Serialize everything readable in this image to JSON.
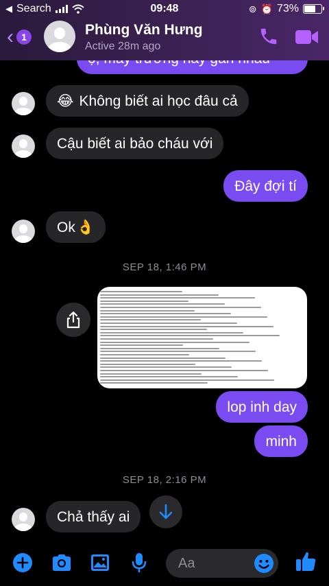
{
  "status": {
    "carrier": "Search",
    "time": "09:48",
    "battery": "73%",
    "battery_level": 0.73
  },
  "header": {
    "back_count": "1",
    "contact_name": "Phùng Văn Hưng",
    "active_status": "Active 28m ago",
    "icons": [
      "back-chevron-icon",
      "phone-icon",
      "video-camera-icon"
    ]
  },
  "messages": [
    {
      "dir": "out",
      "text": "ọ, mấy trường hay gần nhau"
    },
    {
      "dir": "in",
      "emoji": "😂",
      "text": "Không biết ai học đâu cả"
    },
    {
      "dir": "in",
      "text": "Cậu biết ai bảo cháu với"
    },
    {
      "dir": "out",
      "text": "Đây đợi tí"
    },
    {
      "dir": "in",
      "text": "Ok",
      "emoji": "👌"
    },
    {
      "dir": "ts",
      "text": "SEP 18, 1:46 PM"
    },
    {
      "dir": "out",
      "type": "image",
      "alt_icon": "screenshot-image"
    },
    {
      "dir": "out",
      "text": "lop inh day"
    },
    {
      "dir": "out",
      "text": "minh"
    },
    {
      "dir": "ts",
      "text": "SEP 18, 2:16 PM"
    },
    {
      "dir": "in",
      "text": "Chả thấy ai"
    }
  ],
  "composer": {
    "placeholder": "Aa",
    "icons": [
      "plus-icon",
      "camera-icon",
      "gallery-icon",
      "microphone-icon",
      "emoji-icon",
      "thumbs-up-icon"
    ]
  },
  "colors": {
    "accent": "#7b4bf2",
    "incoming": "#262628",
    "composer_blue": "#1f8bff",
    "header_purple": "#3a2150"
  }
}
